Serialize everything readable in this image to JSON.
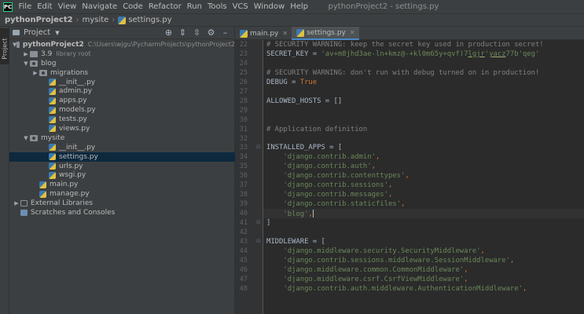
{
  "menubar": {
    "items": [
      "File",
      "Edit",
      "View",
      "Navigate",
      "Code",
      "Refactor",
      "Run",
      "Tools",
      "VCS",
      "Window",
      "Help"
    ],
    "window_title": "pythonProject2 - settings.py"
  },
  "navbar": {
    "crumbs": [
      "pythonProject2",
      "mysite",
      "settings.py"
    ]
  },
  "tool_stripe": {
    "project_label": "Project"
  },
  "project_panel": {
    "title": "Project",
    "tools": [
      "target-icon",
      "expand-all-icon",
      "collapse-all-icon",
      "gear-icon",
      "minimize-icon"
    ],
    "tree": [
      {
        "label": "pythonProject2",
        "note": "C:\\Users\\wjgu\\PycharmProjects\\pythonProject2",
        "kind": "folder",
        "depth": 0,
        "arrow": "open",
        "bold": true
      },
      {
        "label": "3.9",
        "note": "library root",
        "kind": "folder",
        "depth": 1,
        "arrow": "closed"
      },
      {
        "label": "blog",
        "kind": "folder-pkg",
        "depth": 1,
        "arrow": "open"
      },
      {
        "label": "migrations",
        "kind": "folder-pkg",
        "depth": 2,
        "arrow": "closed"
      },
      {
        "label": "__init__.py",
        "kind": "py",
        "depth": 3
      },
      {
        "label": "admin.py",
        "kind": "py",
        "depth": 3
      },
      {
        "label": "apps.py",
        "kind": "py",
        "depth": 3
      },
      {
        "label": "models.py",
        "kind": "py",
        "depth": 3
      },
      {
        "label": "tests.py",
        "kind": "py",
        "depth": 3
      },
      {
        "label": "views.py",
        "kind": "py",
        "depth": 3
      },
      {
        "label": "mysite",
        "kind": "folder-pkg",
        "depth": 1,
        "arrow": "open"
      },
      {
        "label": "__init__.py",
        "kind": "py",
        "depth": 3
      },
      {
        "label": "settings.py",
        "kind": "py",
        "depth": 3,
        "selected": true
      },
      {
        "label": "urls.py",
        "kind": "py",
        "depth": 3
      },
      {
        "label": "wsgi.py",
        "kind": "py",
        "depth": 3
      },
      {
        "label": "main.py",
        "kind": "py",
        "depth": 2
      },
      {
        "label": "manage.py",
        "kind": "py",
        "depth": 2
      },
      {
        "label": "External Libraries",
        "kind": "lib",
        "depth": 0,
        "arrow": "closed"
      },
      {
        "label": "Scratches and Consoles",
        "kind": "scratch",
        "depth": 0
      }
    ]
  },
  "tabs": [
    {
      "label": "main.py",
      "active": false
    },
    {
      "label": "settings.py",
      "active": true
    }
  ],
  "editor": {
    "current_line": 40,
    "lines": [
      {
        "n": 22,
        "segs": [
          [
            "c-com",
            "# SECURITY WARNING: keep the secret key used in production secret!"
          ]
        ]
      },
      {
        "n": 23,
        "segs": [
          [
            "",
            "SECRET_KEY = "
          ],
          [
            "c-str",
            "'av+m8jhd3ae-ln+kmz@-+kl0m65y+qvf)7"
          ],
          [
            "c-str c-ul",
            "lgjr"
          ],
          [
            "c-str",
            "'"
          ],
          [
            "c-str c-ul",
            "yacz"
          ],
          [
            "c-str",
            "77b'qeg'"
          ]
        ]
      },
      {
        "n": 24,
        "segs": []
      },
      {
        "n": 25,
        "segs": [
          [
            "c-com",
            "# SECURITY WARNING: don't run with debug turned on in production!"
          ]
        ]
      },
      {
        "n": 26,
        "segs": [
          [
            "",
            "DEBUG = "
          ],
          [
            "c-kw",
            "True"
          ]
        ]
      },
      {
        "n": 27,
        "segs": []
      },
      {
        "n": 28,
        "segs": [
          [
            "",
            "ALLOWED_HOSTS = []"
          ]
        ]
      },
      {
        "n": 29,
        "segs": []
      },
      {
        "n": 30,
        "segs": []
      },
      {
        "n": 31,
        "segs": [
          [
            "c-com",
            "# Application definition"
          ]
        ]
      },
      {
        "n": 32,
        "segs": []
      },
      {
        "n": 33,
        "segs": [
          [
            "",
            "INSTALLED_APPS = ["
          ]
        ],
        "fold": true
      },
      {
        "n": 34,
        "segs": [
          [
            "",
            "    "
          ],
          [
            "c-str",
            "'django.contrib.admin'"
          ],
          [
            "c-kw",
            ","
          ]
        ]
      },
      {
        "n": 35,
        "segs": [
          [
            "",
            "    "
          ],
          [
            "c-str",
            "'django.contrib.auth'"
          ],
          [
            "c-kw",
            ","
          ]
        ]
      },
      {
        "n": 36,
        "segs": [
          [
            "",
            "    "
          ],
          [
            "c-str",
            "'django.contrib.contenttypes'"
          ],
          [
            "c-kw",
            ","
          ]
        ]
      },
      {
        "n": 37,
        "segs": [
          [
            "",
            "    "
          ],
          [
            "c-str",
            "'django.contrib.sessions'"
          ],
          [
            "c-kw",
            ","
          ]
        ]
      },
      {
        "n": 38,
        "segs": [
          [
            "",
            "    "
          ],
          [
            "c-str",
            "'django.contrib.messages'"
          ],
          [
            "c-kw",
            ","
          ]
        ]
      },
      {
        "n": 39,
        "segs": [
          [
            "",
            "    "
          ],
          [
            "c-str",
            "'django.contrib.staticfiles'"
          ],
          [
            "c-kw",
            ","
          ]
        ]
      },
      {
        "n": 40,
        "segs": [
          [
            "",
            "    "
          ],
          [
            "c-str",
            "'blog'"
          ],
          [
            "c-kw",
            ","
          ]
        ],
        "caret": true
      },
      {
        "n": 41,
        "segs": [
          [
            "",
            "]"
          ]
        ],
        "fold": true
      },
      {
        "n": 42,
        "segs": []
      },
      {
        "n": 43,
        "segs": [
          [
            "",
            "MIDDLEWARE = ["
          ]
        ],
        "fold": true
      },
      {
        "n": 44,
        "segs": [
          [
            "",
            "    "
          ],
          [
            "c-str",
            "'django.middleware.security.SecurityMiddleware'"
          ],
          [
            "c-kw",
            ","
          ]
        ]
      },
      {
        "n": 45,
        "segs": [
          [
            "",
            "    "
          ],
          [
            "c-str",
            "'django.contrib.sessions.middleware.SessionMiddleware'"
          ],
          [
            "c-kw",
            ","
          ]
        ]
      },
      {
        "n": 46,
        "segs": [
          [
            "",
            "    "
          ],
          [
            "c-str",
            "'django.middleware.common.CommonMiddleware'"
          ],
          [
            "c-kw",
            ","
          ]
        ]
      },
      {
        "n": 47,
        "segs": [
          [
            "",
            "    "
          ],
          [
            "c-str",
            "'django.middleware.csrf.CsrfViewMiddleware'"
          ],
          [
            "c-kw",
            ","
          ]
        ]
      },
      {
        "n": 48,
        "segs": [
          [
            "",
            "    "
          ],
          [
            "c-str",
            "'django.contrib.auth.middleware.AuthenticationMiddleware'"
          ],
          [
            "c-kw",
            ","
          ]
        ]
      }
    ]
  },
  "colors": {
    "background": "#2b2b2b",
    "panel": "#3c3f41",
    "selection": "#0d293e",
    "accent": "#4a88c7",
    "string": "#6a8759",
    "keyword": "#cc7832",
    "comment": "#808080"
  }
}
